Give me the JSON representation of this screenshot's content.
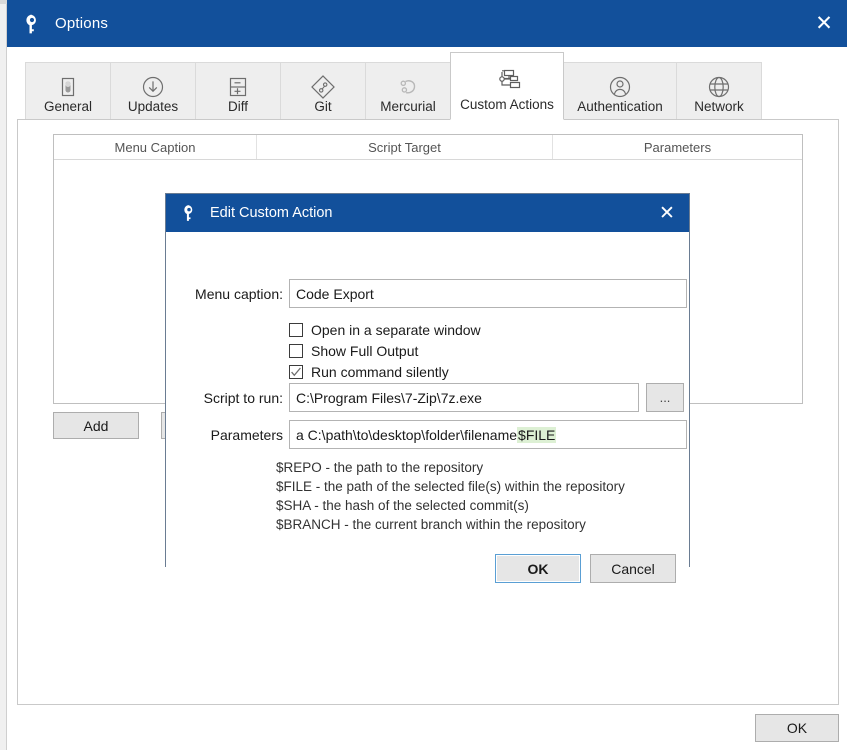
{
  "window": {
    "title": "Options",
    "icon": "keyhole-icon",
    "close_label": "✕",
    "accent_color": "#12509b"
  },
  "tabs": [
    {
      "label": "General",
      "icon": "device-icon",
      "active": false
    },
    {
      "label": "Updates",
      "icon": "download-arrow-icon",
      "active": false
    },
    {
      "label": "Diff",
      "icon": "plus-minus-icon",
      "active": false
    },
    {
      "label": "Git",
      "icon": "git-diamond-icon",
      "active": false
    },
    {
      "label": "Mercurial",
      "icon": "mercurial-icon",
      "active": false
    },
    {
      "label": "Custom Actions",
      "icon": "hierarchy-icon",
      "active": true
    },
    {
      "label": "Authentication",
      "icon": "person-circle-icon",
      "active": false
    },
    {
      "label": "Network",
      "icon": "globe-icon",
      "active": false
    }
  ],
  "custom_actions": {
    "columns": [
      "Menu Caption",
      "Script Target",
      "Parameters"
    ],
    "rows": [],
    "add_button": "Add",
    "second_button": ""
  },
  "footer": {
    "ok_label": "OK"
  },
  "dialog": {
    "title": "Edit Custom Action",
    "icon": "keyhole-icon",
    "close_label": "✕",
    "menu_caption_label": "Menu caption:",
    "menu_caption_value": "Code Export",
    "checkboxes": [
      {
        "label": "Open in a separate window",
        "checked": false
      },
      {
        "label": "Show Full Output",
        "checked": false
      },
      {
        "label": "Run command silently",
        "checked": true
      }
    ],
    "script_label": "Script to run:",
    "script_value": "C:\\Program Files\\7-Zip\\7z.exe",
    "browse_label": "...",
    "parameters_label": "Parameters",
    "parameters_prefix": "a C:\\path\\to\\desktop\\folder\\filename ",
    "parameters_token": "$FILE",
    "parameters_token_color": "#ddf0d4",
    "help_lines": [
      "$REPO - the path to the repository",
      "$FILE - the path of the selected file(s) within the repository",
      "$SHA - the hash of the selected commit(s)",
      "$BRANCH - the current branch within the repository"
    ],
    "ok_label": "OK",
    "cancel_label": "Cancel"
  }
}
